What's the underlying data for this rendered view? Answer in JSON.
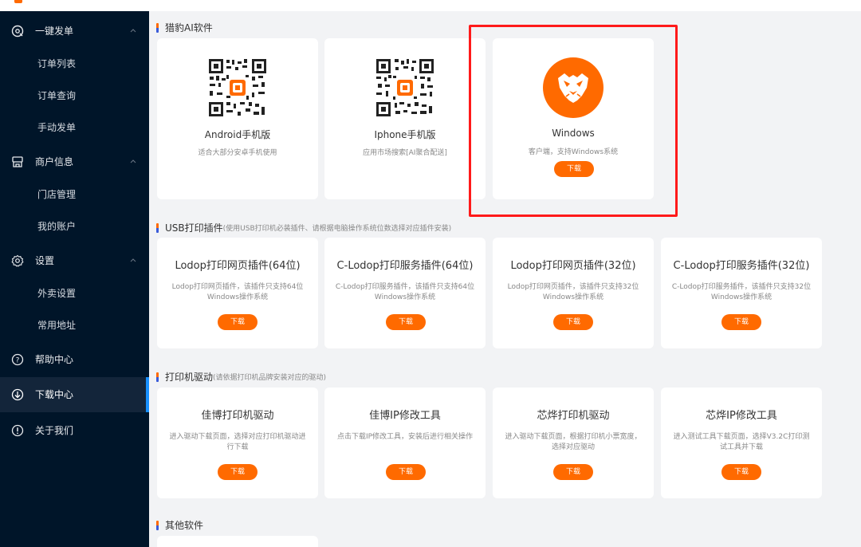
{
  "sidebar": {
    "groups": [
      {
        "label": "一键发单",
        "items": [
          "订单列表",
          "订单查询",
          "手动发单"
        ]
      },
      {
        "label": "商户信息",
        "items": [
          "门店管理",
          "我的账户"
        ]
      },
      {
        "label": "设置",
        "items": [
          "外卖设置",
          "常用地址"
        ]
      }
    ],
    "help": "帮助中心",
    "download": "下载中心",
    "about": "关于我们"
  },
  "sections": {
    "ai_software": {
      "title": "猎豹AI软件"
    },
    "usb_plugins": {
      "title": "USB打印插件",
      "subtitle": "(使用USB打印机必装插件、请根据电脑操作系统位数选择对应插件安装)"
    },
    "printer_drivers": {
      "title": "打印机驱动",
      "subtitle": "(请依据打印机品牌安装对应的驱动)"
    },
    "other_software": {
      "title": "其他软件"
    }
  },
  "ai_cards": [
    {
      "name": "Android手机版",
      "desc": "适合大部分安卓手机使用"
    },
    {
      "name": "Iphone手机版",
      "desc": "应用市场搜索[AI聚合配送]"
    },
    {
      "name": "Windows",
      "desc": "客户端，支持Windows系统",
      "button": "下载"
    }
  ],
  "usb_cards": [
    {
      "name": "Lodop打印网页插件(64位)",
      "desc": "Lodop打印网页插件，该插件只支持64位Windows操作系统",
      "button": "下载"
    },
    {
      "name": "C-Lodop打印服务插件(64位)",
      "desc": "C-Lodop打印服务插件，该插件只支持64位Windows操作系统",
      "button": "下载"
    },
    {
      "name": "Lodop打印网页插件(32位)",
      "desc": "Lodop打印网页插件，该插件只支持32位Windows操作系统",
      "button": "下载"
    },
    {
      "name": "C-Lodop打印服务插件(32位)",
      "desc": "C-Lodop打印服务插件，该插件只支持32位Windows操作系统",
      "button": "下载"
    }
  ],
  "driver_cards": [
    {
      "name": "佳博打印机驱动",
      "desc": "进入驱动下载页面，选择对应打印机驱动进行下载",
      "button": "下载"
    },
    {
      "name": "佳博IP修改工具",
      "desc": "点击下载IP修改工具，安装后进行相关操作",
      "button": "下载"
    },
    {
      "name": "芯烨打印机驱动",
      "desc": "进入驱动下载页面，根据打印机小票宽度，选择对应驱动",
      "button": "下载"
    },
    {
      "name": "芯烨IP修改工具",
      "desc": "进入测试工具下载页面，选择V3.2C打印测试工具并下载",
      "button": "下载"
    }
  ],
  "colors": {
    "accent": "#ff6a00",
    "sidebar_bg": "#001529",
    "active_indicator": "#1890ff",
    "highlight_border": "#ff1a1a"
  },
  "icons": {
    "group1": "compass-icon",
    "group2": "shop-icon",
    "group3": "gear-icon",
    "help": "question-circle-icon",
    "download": "download-circle-icon",
    "about": "info-circle-icon"
  }
}
